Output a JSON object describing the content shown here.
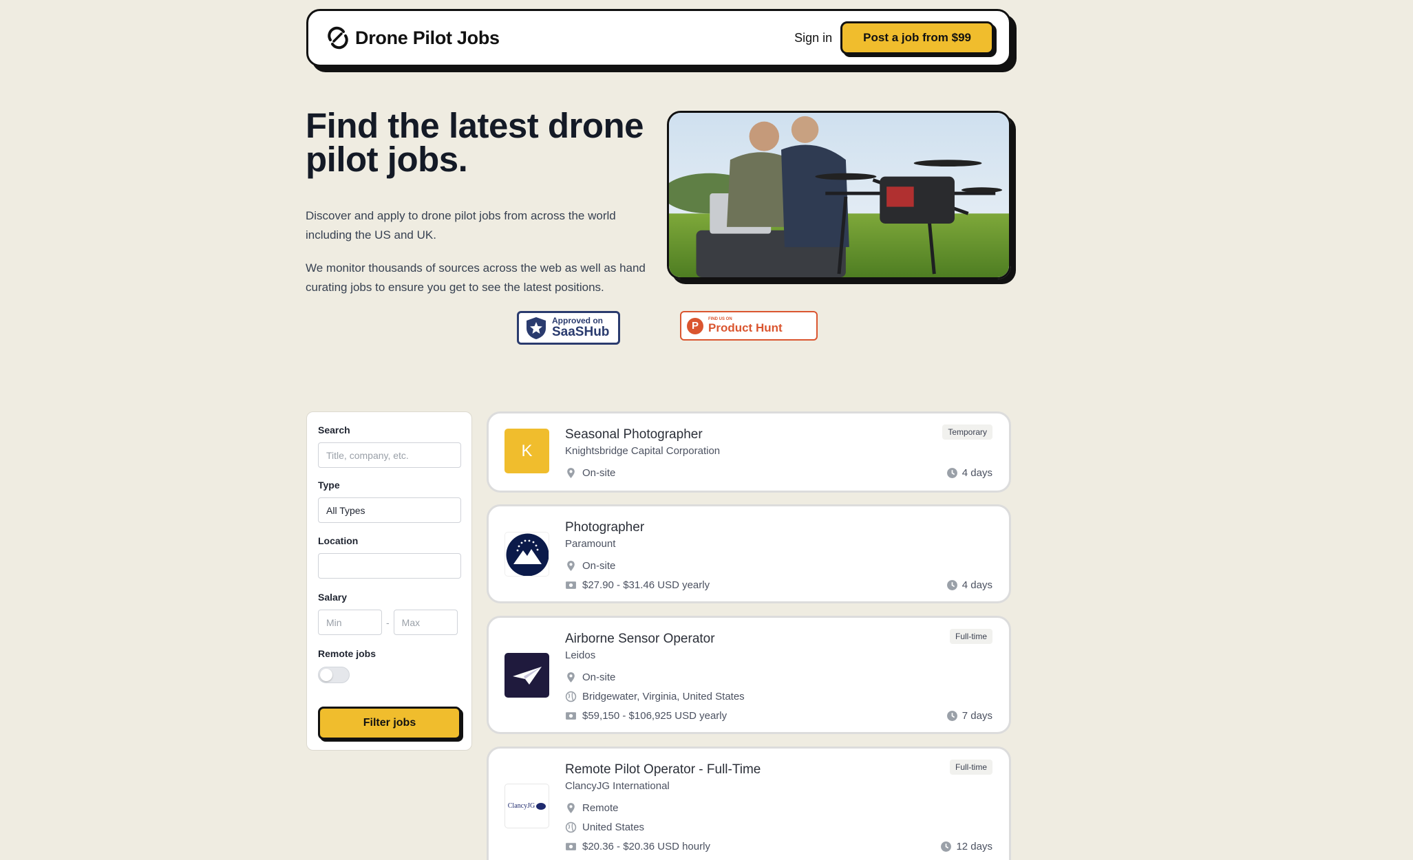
{
  "header": {
    "brand": "Drone Pilot Jobs",
    "sign_in": "Sign in",
    "post_job": "Post a job from $99"
  },
  "hero": {
    "title": "Find the latest drone pilot jobs.",
    "p1": "Discover and apply to drone pilot jobs from across the world including the US and UK.",
    "p2": "We monitor thousands of sources across the web as well as hand curating jobs to ensure you get to see the latest positions.",
    "badge_saashub_top": "Approved on",
    "badge_saashub_name": "SaaSHub",
    "badge_ph_top": "FIND US ON",
    "badge_ph_name": "Product Hunt"
  },
  "filters": {
    "search_label": "Search",
    "search_placeholder": "Title, company, etc.",
    "type_label": "Type",
    "type_value": "All Types",
    "location_label": "Location",
    "location_value": "",
    "salary_label": "Salary",
    "salary_min_placeholder": "Min",
    "salary_max_placeholder": "Max",
    "salary_dash": "-",
    "remote_label": "Remote jobs",
    "remote_on": false,
    "filter_button": "Filter jobs"
  },
  "jobs": [
    {
      "title": "Seasonal Photographer",
      "company": "Knightsbridge Capital Corporation",
      "logo_letter": "K",
      "tag": "Temporary",
      "workplace": "On-site",
      "age": "4 days"
    },
    {
      "title": "Photographer",
      "company": "Paramount",
      "workplace": "On-site",
      "salary": "$27.90 - $31.46 USD yearly",
      "age": "4 days"
    },
    {
      "title": "Airborne Sensor Operator",
      "company": "Leidos",
      "tag": "Full-time",
      "workplace": "On-site",
      "location": "Bridgewater, Virginia, United States",
      "salary": "$59,150 - $106,925 USD yearly",
      "age": "7 days"
    },
    {
      "title": "Remote Pilot Operator - Full-Time",
      "company": "ClancyJG International",
      "logo_text": "ClancyJG",
      "tag": "Full-time",
      "workplace": "Remote",
      "location": "United States",
      "salary": "$20.36 - $20.36 USD hourly",
      "age": "12 days"
    }
  ],
  "colors": {
    "background": "#efece1",
    "accent": "#f0bd2d",
    "ink": "#111111"
  }
}
